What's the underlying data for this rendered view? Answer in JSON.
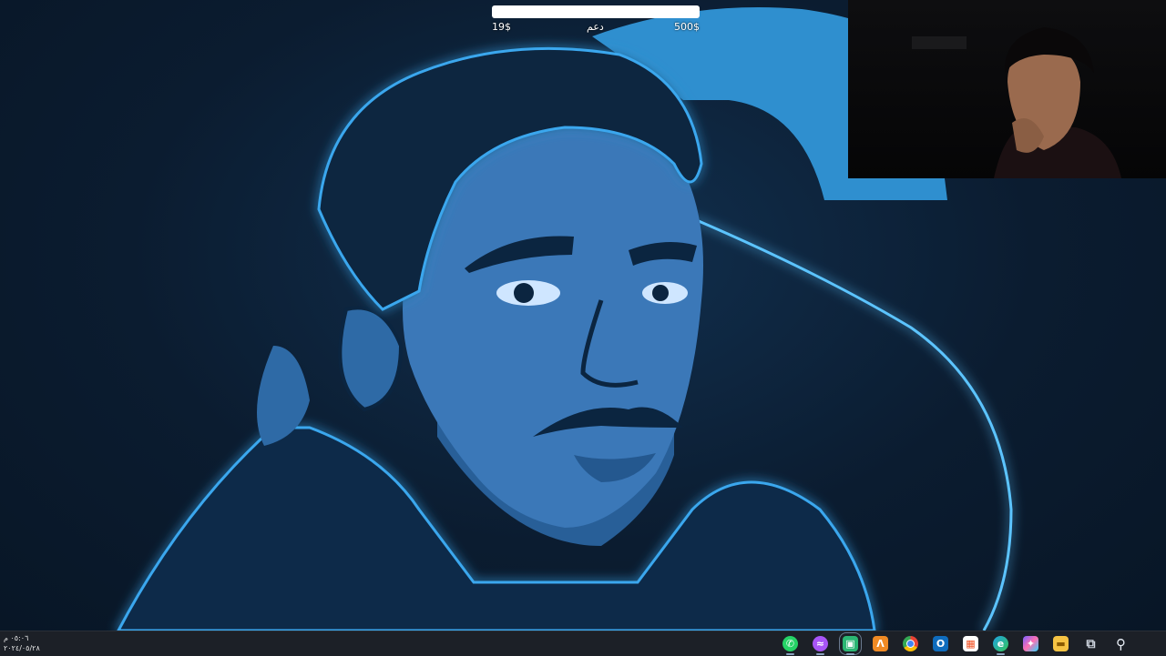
{
  "donation": {
    "min_label": "19$",
    "title": "دعم",
    "max_label": "500$",
    "progress_fraction": 0.0,
    "track_color": "#ffffff"
  },
  "clock": {
    "time": "٠٥:٠٦ م",
    "date": "٢٠٢٤/٠٥/٢٨"
  },
  "taskbar": {
    "icons": [
      {
        "name": "whatsapp-icon",
        "color": "#25d366"
      },
      {
        "name": "messenger-icon",
        "color": "#a855f7"
      },
      {
        "name": "ai-chat-app-icon",
        "color": "#2bb673"
      },
      {
        "name": "vectorizer-app-icon",
        "color": "#f08a24"
      },
      {
        "name": "chrome-icon",
        "color": "#fbbc04"
      },
      {
        "name": "outlook-icon",
        "color": "#0f6cbd"
      },
      {
        "name": "microsoft-store-icon",
        "color": "#f25022"
      },
      {
        "name": "edge-icon",
        "color": "#1fa1e3"
      },
      {
        "name": "copilot-icon",
        "color": "#7b61ff"
      },
      {
        "name": "file-explorer-icon",
        "color": "#f6c343"
      },
      {
        "name": "task-view-icon",
        "color": "#cfd6e0"
      },
      {
        "name": "search-icon",
        "color": "#cfd6e0"
      },
      {
        "name": "windows-start-icon",
        "color": "#ffffff"
      }
    ]
  },
  "colors": {
    "wallpaper_glow": "#3aa7ee",
    "portrait_skin": "#3b78b8",
    "portrait_dark": "#0b2540"
  }
}
